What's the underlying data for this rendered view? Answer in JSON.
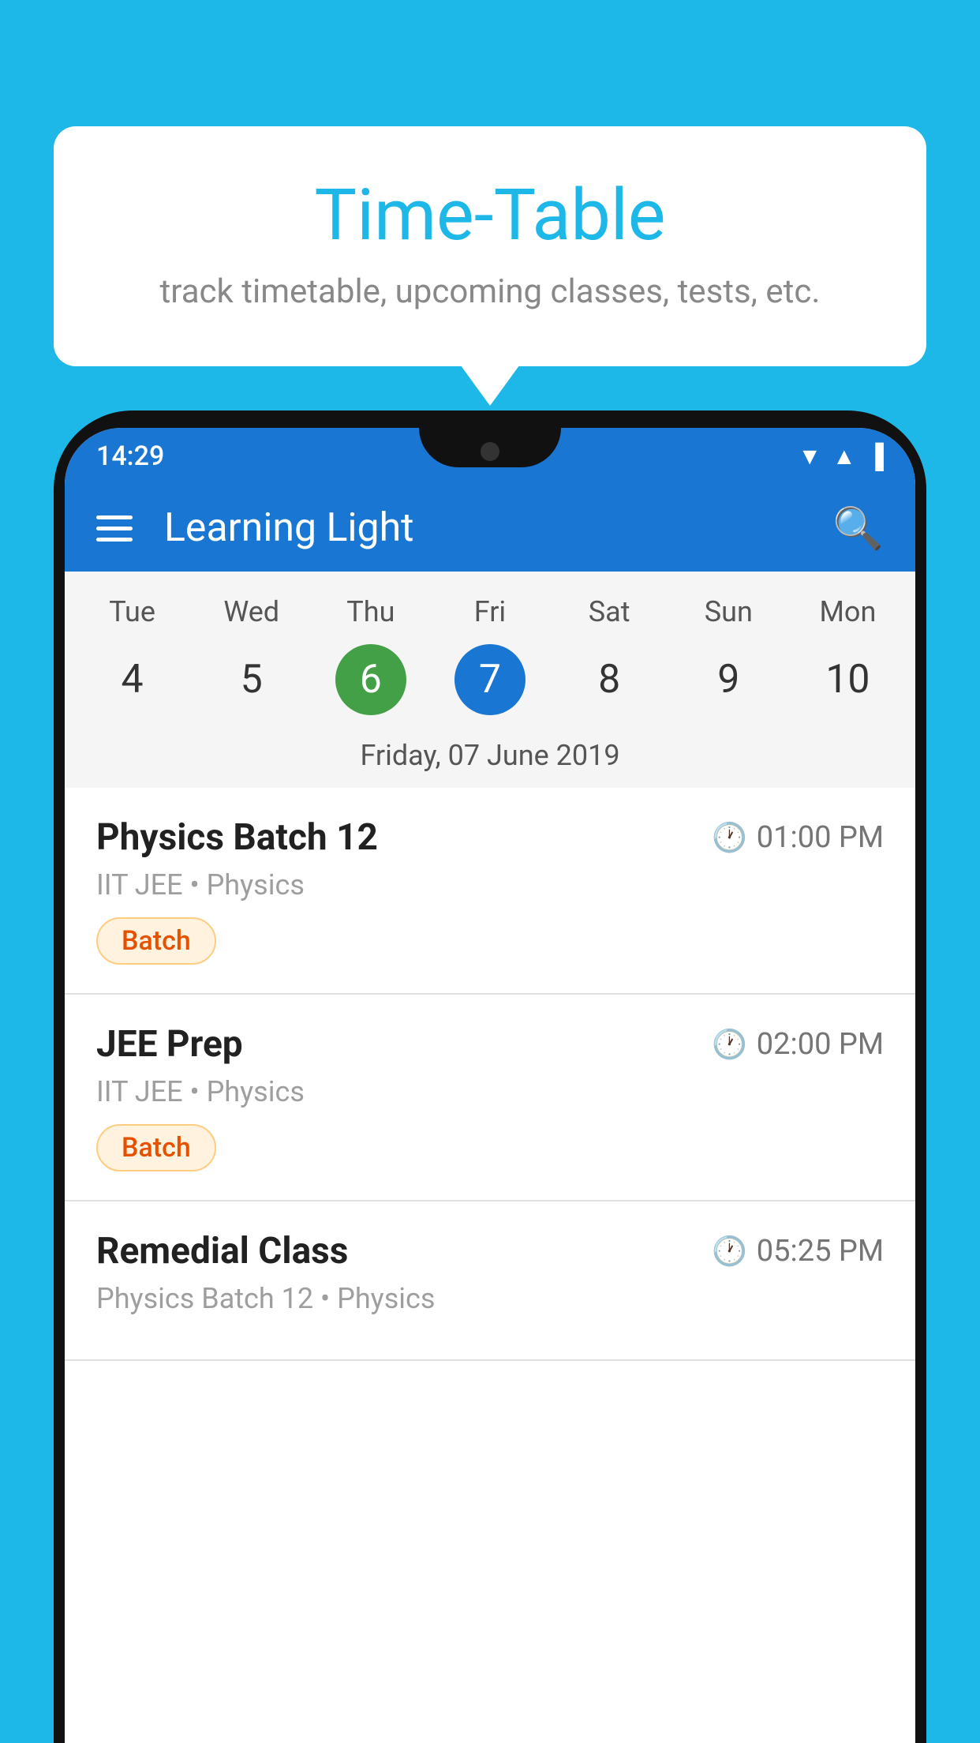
{
  "background_color": "#1db8e8",
  "tooltip": {
    "title": "Time-Table",
    "subtitle": "track timetable, upcoming classes, tests, etc."
  },
  "phone": {
    "status_bar": {
      "time": "14:29"
    },
    "app_bar": {
      "title": "Learning Light"
    },
    "calendar": {
      "days": [
        {
          "label": "Tue",
          "num": "4",
          "state": "normal"
        },
        {
          "label": "Wed",
          "num": "5",
          "state": "normal"
        },
        {
          "label": "Thu",
          "num": "6",
          "state": "today"
        },
        {
          "label": "Fri",
          "num": "7",
          "state": "selected"
        },
        {
          "label": "Sat",
          "num": "8",
          "state": "normal"
        },
        {
          "label": "Sun",
          "num": "9",
          "state": "normal"
        },
        {
          "label": "Mon",
          "num": "10",
          "state": "normal"
        }
      ],
      "selected_date_label": "Friday, 07 June 2019"
    },
    "schedule": [
      {
        "title": "Physics Batch 12",
        "time": "01:00 PM",
        "subtitle": "IIT JEE • Physics",
        "badge": "Batch"
      },
      {
        "title": "JEE Prep",
        "time": "02:00 PM",
        "subtitle": "IIT JEE • Physics",
        "badge": "Batch"
      },
      {
        "title": "Remedial Class",
        "time": "05:25 PM",
        "subtitle": "Physics Batch 12 • Physics",
        "badge": null
      }
    ]
  }
}
